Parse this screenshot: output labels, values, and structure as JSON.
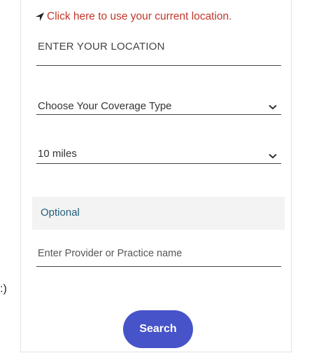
{
  "location": {
    "link_label": "Click here to use your current location.",
    "link_icon": "location-arrow-icon",
    "input_placeholder": "ENTER YOUR LOCATION"
  },
  "coverage": {
    "selected": "Choose Your Coverage Type",
    "icon": "chevron-down-icon"
  },
  "distance": {
    "selected": "10 miles",
    "icon": "chevron-down-icon"
  },
  "optional": {
    "label": "Optional",
    "provider_placeholder": "Enter Provider or Practice name"
  },
  "actions": {
    "search_label": "Search"
  },
  "stray_text": ":)",
  "colors": {
    "link": "#c0392b",
    "optional_label": "#1f5f78",
    "button_bg": "#4653c9",
    "optional_bg": "#f3f3f3"
  }
}
